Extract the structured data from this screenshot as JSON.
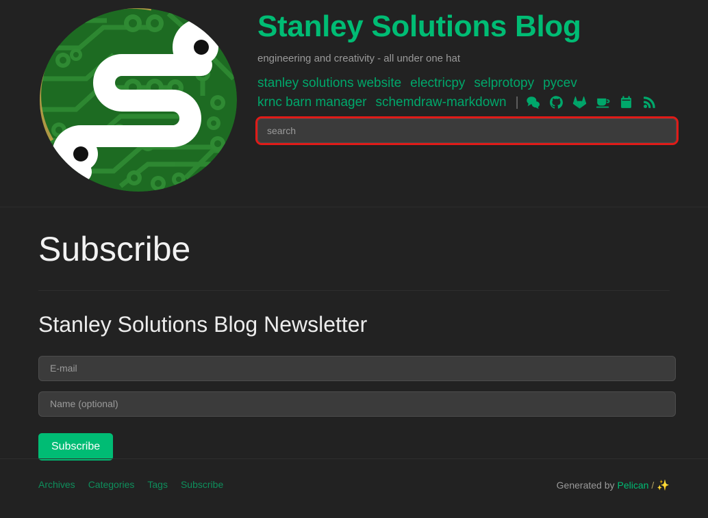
{
  "header": {
    "logo_alt": "stanley-solutions-pcb-logo",
    "title": "Stanley Solutions Blog",
    "tagline": "engineering and creativity - all under one hat",
    "nav_row_1": [
      {
        "label": "stanley solutions website",
        "name": "nav-link-stanley-solutions-website"
      },
      {
        "label": "electricpy",
        "name": "nav-link-electricpy"
      },
      {
        "label": "selprotopy",
        "name": "nav-link-selprotopy"
      },
      {
        "label": "pycev",
        "name": "nav-link-pycev"
      }
    ],
    "nav_row_2": [
      {
        "label": "krnc barn manager",
        "name": "nav-link-krnc-barn-manager"
      },
      {
        "label": "schemdraw-markdown",
        "name": "nav-link-schemdraw-markdown"
      }
    ],
    "nav_separator": "|",
    "social_icons": [
      {
        "name": "comments-icon",
        "title": "comments"
      },
      {
        "name": "github-icon",
        "title": "github"
      },
      {
        "name": "gitlab-icon",
        "title": "gitlab"
      },
      {
        "name": "coffee-icon",
        "title": "coffee"
      },
      {
        "name": "calendar-icon",
        "title": "calendar"
      },
      {
        "name": "rss-feed-icon",
        "title": "rss feed"
      }
    ],
    "search": {
      "placeholder": "search",
      "value": "",
      "highlight_color": "#e01b18"
    }
  },
  "main": {
    "page_title": "Subscribe",
    "newsletter_title": "Stanley Solutions Blog Newsletter",
    "form": {
      "email_placeholder": "E-mail",
      "email_value": "",
      "name_placeholder": "Name (optional)",
      "name_value": "",
      "submit_label": "Subscribe"
    }
  },
  "footer": {
    "links": [
      {
        "label": "Archives",
        "name": "footer-link-archives"
      },
      {
        "label": "Categories",
        "name": "footer-link-categories"
      },
      {
        "label": "Tags",
        "name": "footer-link-tags"
      },
      {
        "label": "Subscribe",
        "name": "footer-link-subscribe"
      }
    ],
    "credit_prefix": "Generated by",
    "credit_link": "Pelican",
    "credit_slash": "/",
    "credit_sparkle": "✨"
  },
  "colors": {
    "background": "#222222",
    "accent_green": "#00bc74",
    "link_green": "#00a86b",
    "footer_link_green": "#0e8f5c",
    "muted_text": "#9a9a9a",
    "highlight_red": "#e01b18"
  }
}
